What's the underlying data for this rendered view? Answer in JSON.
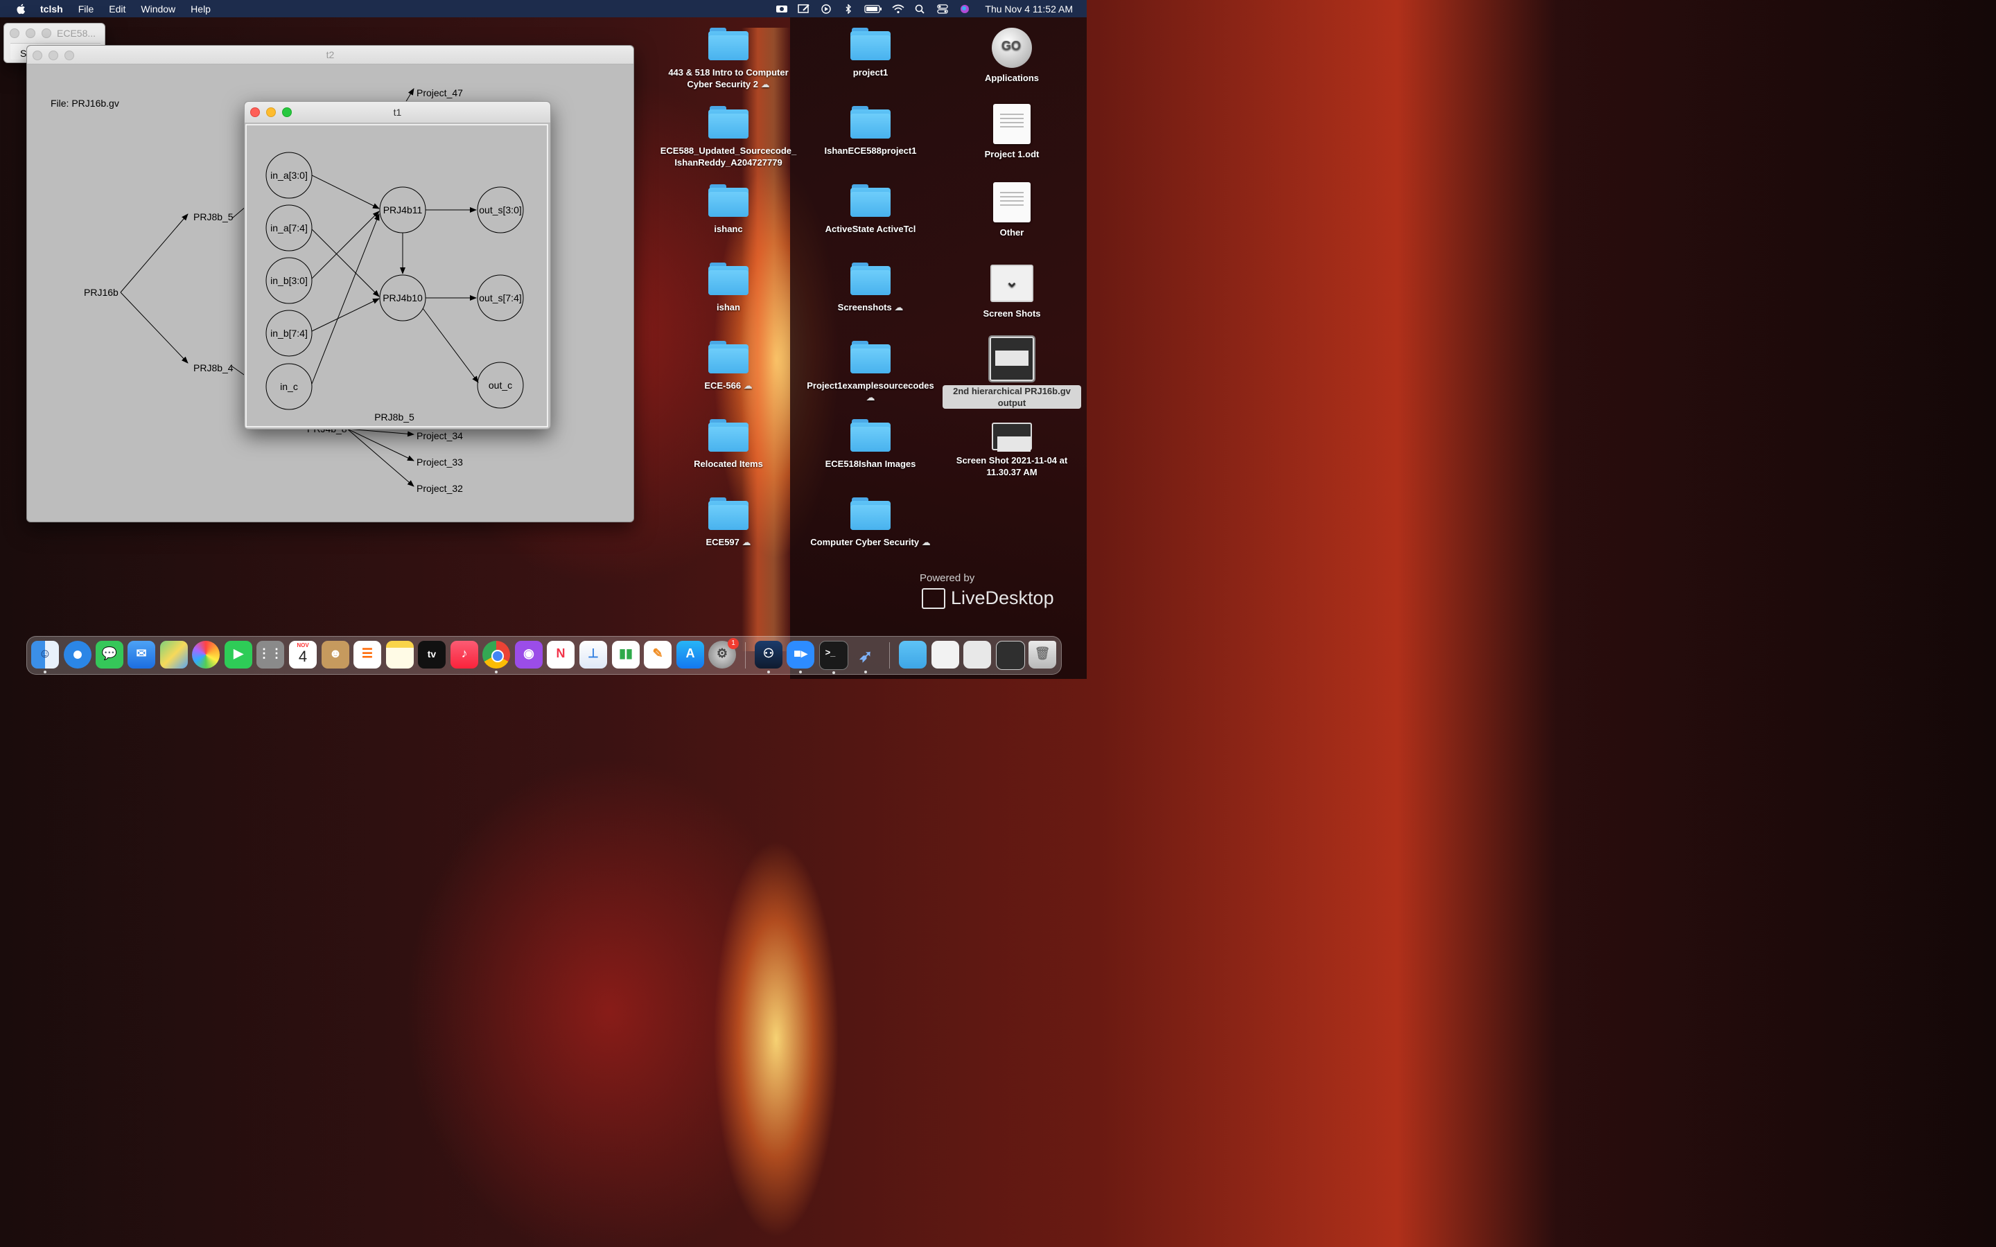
{
  "menubar": {
    "app_name": "tclsh",
    "items": [
      "File",
      "Edit",
      "Window",
      "Help"
    ],
    "clock": "Thu Nov 4  11:52 AM"
  },
  "background_windows": {
    "ece_title": "ECE58...",
    "ece_button": "St"
  },
  "t2_window": {
    "title": "t2",
    "file_label": "File: PRJ16b.gv",
    "nodes": {
      "root": "PRJ16b",
      "prj8b5": "PRJ8b_5",
      "prj8b4": "PRJ8b_4",
      "prj4b": "PRJ4b_8",
      "p47": "Project_47",
      "p34": "Project_34",
      "p33": "Project_33",
      "p32": "Project_32"
    }
  },
  "t1_window": {
    "title": "t1",
    "caption": "PRJ8b_5",
    "nodes": {
      "in_a_lo": "in_a[3:0]",
      "in_a_hi": "in_a[7:4]",
      "in_b_lo": "in_b[3:0]",
      "in_b_hi": "in_b[7:4]",
      "in_c": "in_c",
      "prj4b11": "PRJ4b11",
      "prj4b10": "PRJ4b10",
      "out_s_lo": "out_s[3:0]",
      "out_s_hi": "out_s[7:4]",
      "out_c": "out_c"
    }
  },
  "desktop": {
    "col1": [
      {
        "label": "443 & 518 Intro to Computer Cyber Security 2",
        "icon": "folder-icon",
        "cloud": true
      },
      {
        "label": "ECE588_Updated_Sourcecode_IshanReddy_A204727779",
        "icon": "folder-icon"
      },
      {
        "label": "ishanc",
        "icon": "folder-icon"
      },
      {
        "label": "ishan",
        "icon": "folder-icon"
      },
      {
        "label": "ECE-566",
        "icon": "folder-icon",
        "cloud": true
      },
      {
        "label": "Relocated Items",
        "icon": "folder-alias-icon"
      },
      {
        "label": "ECE597",
        "icon": "folder-icon",
        "cloud": true
      }
    ],
    "col2": [
      {
        "label": "project1",
        "icon": "folder-icon"
      },
      {
        "label": "IshanECE588project1",
        "icon": "folder-icon"
      },
      {
        "label": "ActiveState ActiveTcl",
        "icon": "folder-alias-icon"
      },
      {
        "label": "Screenshots",
        "icon": "folder-icon",
        "cloud": true
      },
      {
        "label": "Project1examplesourcecodes",
        "icon": "folder-icon",
        "cloud": true
      },
      {
        "label": "ECE518Ishan Images",
        "icon": "folder-icon"
      },
      {
        "label": "Computer Cyber Security",
        "icon": "folder-icon",
        "cloud": true
      }
    ],
    "col3": [
      {
        "label": "Applications",
        "icon": "applications-icon"
      },
      {
        "label": "Project 1.odt",
        "icon": "document-icon"
      },
      {
        "label": "Other",
        "icon": "documents-stack-icon"
      },
      {
        "label": "Screen Shots",
        "icon": "screen-shots-icon"
      },
      {
        "label": "2nd hierarchical PRJ16b.gv output",
        "icon": "screenshot-thumbnail-icon",
        "selected": true
      },
      {
        "label": "Screen Shot 2021-11-04 at 11.30.37 AM",
        "icon": "screenshot-thumbnail-icon"
      }
    ]
  },
  "watermark": {
    "powered": "Powered by",
    "brand": "LiveDesktop"
  },
  "dock": {
    "calendar_month": "NOV",
    "calendar_day": "4",
    "tv_label": "tv",
    "settings_badge": "1",
    "apps": [
      "finder-icon",
      "safari-icon",
      "messages-icon",
      "mail-icon",
      "maps-icon",
      "photos-icon",
      "facetime-icon",
      "launchpad-icon",
      "calendar-icon",
      "contacts-icon",
      "reminders-icon",
      "notes-icon",
      "appletv-icon",
      "music-icon",
      "chrome-icon",
      "podcasts-icon",
      "news-icon",
      "keynote-icon",
      "numbers-icon",
      "pages-icon",
      "appstore-icon",
      "system-preferences-icon",
      "steam-icon",
      "zoom-icon",
      "terminal-icon",
      "feather-icon",
      "folder-stack-icon",
      "doc-stack-icon",
      "screenshot-stack-icon",
      "screenshot-stack2-icon",
      "trash-icon"
    ]
  },
  "colors": {
    "menubar": "#1d2c4c",
    "graph_bg": "#bdbdbd",
    "folder": "#4fb4ee",
    "close": "#fe5f57",
    "minimize": "#febc2e",
    "maximize": "#28c840"
  }
}
